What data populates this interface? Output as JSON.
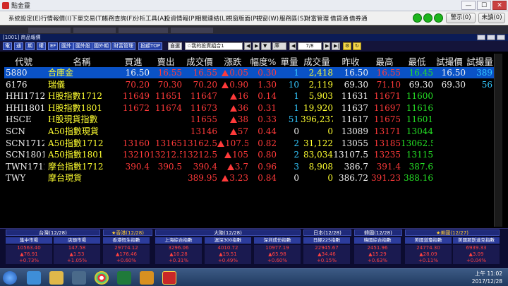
{
  "window": {
    "title": "點金靈",
    "min": "—",
    "max": "☐",
    "close": "✕"
  },
  "menu": {
    "items": [
      "系統設定(E)",
      "行情報價(I)",
      "下單交易(T)",
      "帳務查詢(F)",
      "分析工具(A)",
      "投資情報(P)",
      "相關連結(L)",
      "視窗版面(P)",
      "視窗(W)",
      "服務區(S)",
      "財富管理",
      "借貸通",
      "借券通"
    ],
    "alert_btn": "警示(0)",
    "unread_btn": "未讀(0)"
  },
  "panel": {
    "title": "[1001] 商品報價"
  },
  "toolbar": {
    "buttons": [
      "電",
      "通",
      "期",
      "權",
      "EF",
      "國外",
      "國外股",
      "國外期",
      "財富管理",
      "投顧TOP",
      "自選"
    ],
    "portfolio": "☆我的投資組合1",
    "page": "7/8",
    "extra": "庫"
  },
  "table": {
    "headers": [
      "代號",
      "名稱",
      "買進",
      "賣出",
      "成交價",
      "漲跌",
      "幅度%",
      "單量",
      "成交量",
      "昨收",
      "最高",
      "最低",
      "試撮價",
      "試撮量"
    ],
    "rows": [
      {
        "code": "5880",
        "name": "合庫金",
        "bid": "16.50",
        "ask": "16.55",
        "last": "16.55",
        "chg": "0.05",
        "pct": "0.30",
        "vol": "1",
        "tvol": "2,418",
        "prev": "16.50",
        "high": "16.55",
        "low": "16.45",
        "tp": "16.50",
        "tq": "389",
        "selected": true
      },
      {
        "code": "6176",
        "name": "瑞儀",
        "bid": "70.20",
        "ask": "70.30",
        "last": "70.20",
        "chg": "0.90",
        "pct": "1.30",
        "vol": "10",
        "tvol": "2,119",
        "prev": "69.30",
        "high": "71.10",
        "low": "69.30",
        "tp": "69.30",
        "tq": "56",
        "selected": false
      },
      {
        "code": "HHI1712",
        "name": "H股指數1712",
        "bid": "11649",
        "ask": "11651",
        "last": "11647",
        "chg": "16",
        "pct": "0.14",
        "vol": "1",
        "tvol": "5,903",
        "prev": "11631",
        "high": "11671",
        "low": "11600",
        "tp": "",
        "tq": "",
        "selected": false
      },
      {
        "code": "HHI1801",
        "name": "H股指數1801",
        "bid": "11672",
        "ask": "11674",
        "last": "11673",
        "chg": "36",
        "pct": "0.31",
        "vol": "1",
        "tvol": "19,920",
        "prev": "11637",
        "high": "11697",
        "low": "11616",
        "tp": "",
        "tq": "",
        "selected": false
      },
      {
        "code": "HSCE",
        "name": "H股現貨指數",
        "bid": "",
        "ask": "",
        "last": "11655",
        "chg": "38",
        "pct": "0.33",
        "vol": "51",
        "tvol": "396,237",
        "prev": "11617",
        "high": "11675",
        "low": "11601",
        "tp": "",
        "tq": "",
        "selected": false
      },
      {
        "code": "SCN",
        "name": "A50指數現貨",
        "bid": "",
        "ask": "",
        "last": "13146",
        "chg": "57",
        "pct": "0.44",
        "vol": "0",
        "tvol": "0",
        "prev": "13089",
        "high": "13171",
        "low": "13044",
        "tp": "",
        "tq": "",
        "selected": false
      },
      {
        "code": "SCN1712",
        "name": "A50指數1712",
        "bid": "13160",
        "ask": "13165",
        "last": "13162.5",
        "chg": "107.5",
        "pct": "0.82",
        "vol": "2",
        "tvol": "31,122",
        "prev": "13055",
        "high": "13185",
        "low": "13062.5",
        "tp": "",
        "tq": "",
        "selected": false
      },
      {
        "code": "SCN1801",
        "name": "A50指數1801",
        "bid": "13210",
        "ask": "13212.5",
        "last": "13212.5",
        "chg": "105",
        "pct": "0.80",
        "vol": "2",
        "tvol": "83,034",
        "prev": "13107.5",
        "high": "13235",
        "low": "13115",
        "tp": "",
        "tq": "",
        "selected": false
      },
      {
        "code": "TWN1712",
        "name": "摩台指數1712",
        "bid": "390.4",
        "ask": "390.5",
        "last": "390.4",
        "chg": "3.7",
        "pct": "0.96",
        "vol": "3",
        "tvol": "8,908",
        "prev": "386.7",
        "high": "391.4",
        "low": "387.6",
        "tp": "",
        "tq": "",
        "selected": false
      },
      {
        "code": "TWY",
        "name": "摩台現貨",
        "bid": "",
        "ask": "",
        "last": "389.95",
        "chg": "3.23",
        "pct": "0.84",
        "vol": "0",
        "tvol": "0",
        "prev": "386.72",
        "high": "391.23",
        "low": "388.16",
        "tp": "",
        "tq": "",
        "selected": false
      }
    ]
  },
  "ticker": {
    "groups": [
      "台灣(12/28)",
      "★香港(12/28)",
      "大陸(12/28)",
      "日本(12/28)",
      "韓國(12/28)",
      "★美國(12/27)"
    ],
    "markets": [
      {
        "name": "集中市場",
        "value": "10563.40",
        "change": "▲76.91",
        "pct": "+0.73%"
      },
      {
        "name": "店頭市場",
        "value": "147.58",
        "change": "▲1.53",
        "pct": "+1.05%"
      },
      {
        "name": "香港恆生指數",
        "value": "29774.12",
        "change": "▲176.46",
        "pct": "+0.60%"
      },
      {
        "name": "上海綜合指數",
        "value": "3296.06",
        "change": "▲10.28",
        "pct": "+0.31%"
      },
      {
        "name": "滬深300指數",
        "value": "4010.72",
        "change": "▲19.51",
        "pct": "+0.49%"
      },
      {
        "name": "深圳成份指數",
        "value": "10977.19",
        "change": "▲65.98",
        "pct": "+0.60%"
      },
      {
        "name": "日經225指數",
        "value": "22945.67",
        "change": "▲34.46",
        "pct": "+0.15%"
      },
      {
        "name": "韓國綜合指數",
        "value": "2451.96",
        "change": "▲15.29",
        "pct": "+0.63%"
      },
      {
        "name": "美國道瓊指數",
        "value": "24774.30",
        "change": "▲28.09",
        "pct": "+0.11%"
      },
      {
        "name": "美國那斯達克指數",
        "value": "6939.33",
        "change": "▲3.09",
        "pct": "+0.04%"
      }
    ]
  },
  "taskbar": {
    "time": "上午 11:02",
    "date": "2017/12/28"
  },
  "colors": {
    "up": "#ff3a3a",
    "down": "#25e025",
    "flat": "#ffff30",
    "selected_row": "#0a52c6"
  }
}
